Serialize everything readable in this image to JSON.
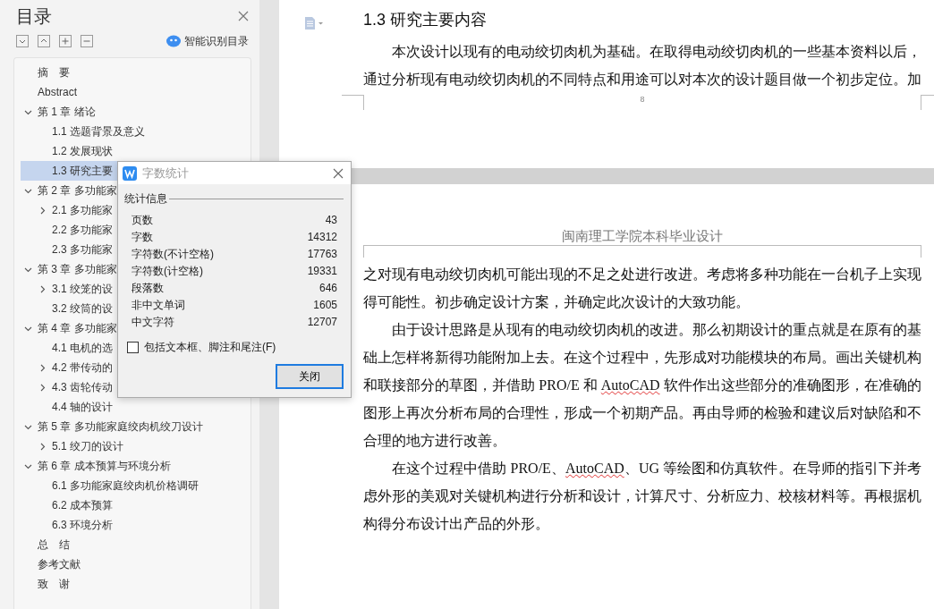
{
  "outline_panel": {
    "title": "目录",
    "smart_button": "智能识别目录",
    "items": [
      {
        "label": "摘　要"
      },
      {
        "label": "Abstract"
      },
      {
        "label": "第 1 章  绪论",
        "expanded": true,
        "selected": false,
        "children": [
          {
            "label": "1.1 选题背景及意义",
            "selected": false
          },
          {
            "label": "1.2 发展现状",
            "selected": false
          },
          {
            "label": "1.3 研究主要",
            "selected": true
          }
        ]
      },
      {
        "label": "第 2 章  多功能家",
        "expanded": true,
        "selected": false,
        "children": [
          {
            "label": "2.1 多功能家",
            "expanded": false,
            "selected": false
          },
          {
            "label": "2.2 多功能家",
            "selected": false
          },
          {
            "label": "2.3 多功能家",
            "selected": false
          }
        ]
      },
      {
        "label": "第 3 章  多功能家",
        "expanded": true,
        "selected": false,
        "children": [
          {
            "label": "3.1 绞笼的设",
            "expanded": false,
            "selected": false
          },
          {
            "label": "3.2 绞筒的设",
            "selected": false
          }
        ]
      },
      {
        "label": "第 4 章  多功能家",
        "expanded": true,
        "selected": false,
        "children": [
          {
            "label": "4.1 电机的选",
            "selected": false
          },
          {
            "label": "4.2 带传动的",
            "expanded": false,
            "selected": false
          },
          {
            "label": "4.3 齿轮传动",
            "expanded": false,
            "selected": false
          },
          {
            "label": "4.4 轴的设计",
            "selected": false
          }
        ]
      },
      {
        "label": "第 5 章  多功能家庭绞肉机绞刀设计",
        "expanded": true,
        "selected": false,
        "children": [
          {
            "label": "5.1 绞刀的设计",
            "expanded": false,
            "selected": false
          }
        ]
      },
      {
        "label": "第 6 章  成本预算与环境分析",
        "expanded": true,
        "selected": false,
        "children": [
          {
            "label": "6.1  多功能家庭绞肉机价格调研",
            "selected": false
          },
          {
            "label": "6.2  成本预算",
            "selected": false
          },
          {
            "label": "6.3  环境分析",
            "selected": false
          }
        ]
      },
      {
        "label": "总　结",
        "selected": false
      },
      {
        "label": "参考文献",
        "selected": false
      },
      {
        "label": "致　谢",
        "selected": false
      }
    ]
  },
  "document": {
    "page_1": {
      "heading": "1.3 研究主要内容",
      "paragraph": {
        "indent": true,
        "segments": [
          {
            "text": "本次设计以现有的电动绞切肉机为基础。在取得电动绞切肉机的一些基本资料以后，通过分析现有电动绞切肉机的不同特点和用途可以对本次的设计题目做一个初步定位。加",
            "misspelled": false
          }
        ]
      },
      "page_number": "8"
    },
    "page_2": {
      "header": "闽南理工学院本科毕业设计",
      "paragraphs": [
        {
          "indent": false,
          "segments": [
            {
              "text": "之对现有电动绞切肉机可能出现的不足之处进行改进。考虑将多种功能在一台机子上实现得可能性。初步确定设计方案，并确定此次设计的大致功能。",
              "misspelled": false
            }
          ]
        },
        {
          "indent": true,
          "segments": [
            {
              "text": "由于设计思路是从现有的电动绞切肉机的改进。那么初期设计的重点就是在原有的基础上怎样将新得功能附加上去。在这个过程中，先形成对功能模块的布局。画出关键机构和联接部分的草图，并借助 PRO/E 和 ",
              "misspelled": false
            },
            {
              "text": "AutoCAD",
              "misspelled": true
            },
            {
              "text": " 软件作出这些部分的准确图形，在准确的图形上再次分析布局的合理性，形成一个初期产品。再由导师的检验和建议后对缺陷和不合理的地方进行改善。",
              "misspelled": false
            }
          ]
        },
        {
          "indent": true,
          "segments": [
            {
              "text": "在这个过程中借助 PRO/E、",
              "misspelled": false
            },
            {
              "text": "AutoCAD",
              "misspelled": true
            },
            {
              "text": "、UG 等绘图和仿真软件。在导师的指引下并考虑外形的美观对关键机构进行分析和设计，计算尺寸、分析应力、校核材料等。再根据机构得分布设计出产品的外形。",
              "misspelled": false
            }
          ]
        }
      ]
    }
  },
  "word_count_dialog": {
    "title": "字数统计",
    "group_label": "统计信息",
    "stats": [
      {
        "label": "页数",
        "value": "43"
      },
      {
        "label": "字数",
        "value": "14312"
      },
      {
        "label": "字符数(不计空格)",
        "value": "17763"
      },
      {
        "label": "字符数(计空格)",
        "value": "19331"
      },
      {
        "label": "段落数",
        "value": "646"
      },
      {
        "label": "非中文单词",
        "value": "1605"
      },
      {
        "label": "中文字符",
        "value": "12707"
      }
    ],
    "include_checkbox": {
      "label": "包括文本框、脚注和尾注(F)",
      "checked": false
    },
    "close_button": "关闭"
  }
}
